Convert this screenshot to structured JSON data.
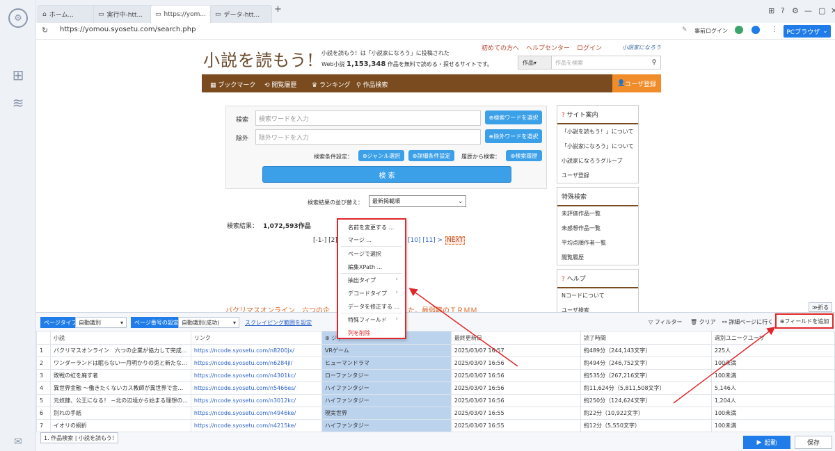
{
  "tabs": [
    {
      "label": "ホーム..."
    },
    {
      "label": "実行中-htt..."
    },
    {
      "label": "https://yom..."
    },
    {
      "label": "データ-htt..."
    }
  ],
  "addressbar": {
    "url": "https://yomou.syosetu.com/search.php",
    "login_label": "事前ログイン",
    "browser_label": "PCブラウザ"
  },
  "site": {
    "logo": "小説を読もう!",
    "tagline1": "小説を読もう！は「小説家になろう」に投稿された",
    "tagline2_prefix": "Web小説",
    "tagline2_count": "1,153,348",
    "tagline2_suffix": "作品を無料で読める・探せるサイトです。",
    "toplinks": [
      "初めての方へ",
      "ヘルプセンター",
      "ログイン"
    ],
    "narou": "小説家になろう",
    "search_select": "作品",
    "search_placeholder": "作品を検索",
    "nav": [
      "ブックマーク",
      "閲覧履歴",
      "ランキング",
      "作品検索"
    ],
    "register": "ユーザ登録",
    "search_label": "検索",
    "search_word_placeholder": "検索ワードを入力",
    "search_word_btn": "検索ワードを選択",
    "exclude_label": "除外",
    "exclude_placeholder": "除外ワードを入力",
    "exclude_btn": "除外ワードを選択",
    "cond_label": "検索条件設定：",
    "genre_btn": "ジャンル選択",
    "detail_btn": "詳細条件設定",
    "history_label": "履歴から検索：",
    "history_btn": "検索履歴",
    "search_btn": "検 索",
    "sort_label": "検索結果の並び替え：",
    "sort_value": "最新掲載順",
    "result_label": "検索結果：",
    "result_count": "1,072,593作品",
    "pager_left": "[-1-] [2]",
    "pager_right": "[10] [11] > >",
    "pager_next": "NEXT",
    "first_title": "パクリマスオンライン　六つの企",
    "first_title_tail": "た。最弱職のＴＲＭＭ",
    "side_info_title": "サイト案内",
    "side_info_items": [
      "「小説を読もう！」について",
      "「小説家になろう」について",
      "小説家になろうグループ",
      "ユーザ登録"
    ],
    "side_special_title": "特殊検索",
    "side_special_items": [
      "未評価作品一覧",
      "未感想作品一覧",
      "平均点順作者一覧",
      "閲覧履歴"
    ],
    "side_help_title": "ヘルプ",
    "side_help_items": [
      "Nコードについて",
      "ユーザ検索"
    ],
    "fold": "折る"
  },
  "context_menu": [
    "名前を変更する ...",
    "マージ ...",
    "ページで選択",
    "編集XPath ...",
    "抽出タイプ",
    "デコードタイプ",
    "データを修正する ...",
    "特殊フィールド",
    "列を削除"
  ],
  "panel": {
    "page_type_label": "ページタイプ",
    "page_type_value": "自動識別",
    "page_num_label": "ページ番号の設定",
    "page_num_value": "自動識別(成功)",
    "scrape_range": "スクレイピング範囲を設定",
    "filter": "フィルター",
    "clear": "クリア",
    "detail": "詳細ページに行く",
    "add_field": "フィールドを追加",
    "columns": [
      "小説",
      "リンク",
      "ジャ",
      "最終更新日",
      "読了時間",
      "週別ユニークユーザ"
    ],
    "rows": [
      [
        "1",
        "パクリマスオンライン　六つの企業が協力して完成...",
        "https://ncode.syosetu.com/n8200jx/",
        "VRゲーム",
        "2025/03/07 16:57",
        "約489分（244,143文字）",
        "225人"
      ],
      [
        "2",
        "ワンダーランドは眠らない一月明かりの兎と新たな...",
        "https://ncode.syosetu.com/n6284jl/",
        "ヒューマンドラマ",
        "2025/03/07 16:56",
        "約494分（246,752文字）",
        "100未満"
      ],
      [
        "3",
        "敗戦の虹を廃す者",
        "https://ncode.syosetu.com/n4301kc/",
        "ローファンタジー",
        "2025/03/07 16:56",
        "約535分（267,216文字）",
        "100未満"
      ],
      [
        "4",
        "異世界金融 〜働きたくないカス教師が異世界で金...",
        "https://ncode.syosetu.com/n5466es/",
        "ハイファンタジー",
        "2025/03/07 16:56",
        "約11,624分（5,811,508文字）",
        "5,146人"
      ],
      [
        "5",
        "元奴隷、公王になる！ ~北の辺境から始まる理想の...",
        "https://ncode.syosetu.com/n3012kc/",
        "ハイファンタジー",
        "2025/03/07 16:56",
        "約250分（124,624文字）",
        "1,204人"
      ],
      [
        "6",
        "別れの手紙",
        "https://ncode.syosetu.com/n4946ke/",
        "現実世界",
        "2025/03/07 16:55",
        "約22分（10,922文字）",
        "100未満"
      ],
      [
        "7",
        "イオリの綱折",
        "https://ncode.syosetu.com/n4215ke/",
        "ハイファンタジー",
        "2025/03/07 16:55",
        "約12分（5,550文字）",
        "100未満"
      ]
    ],
    "task_tab": "1. 作品検索 | 小説を読もう！",
    "start_btn": "起動",
    "save_btn": "保存"
  }
}
